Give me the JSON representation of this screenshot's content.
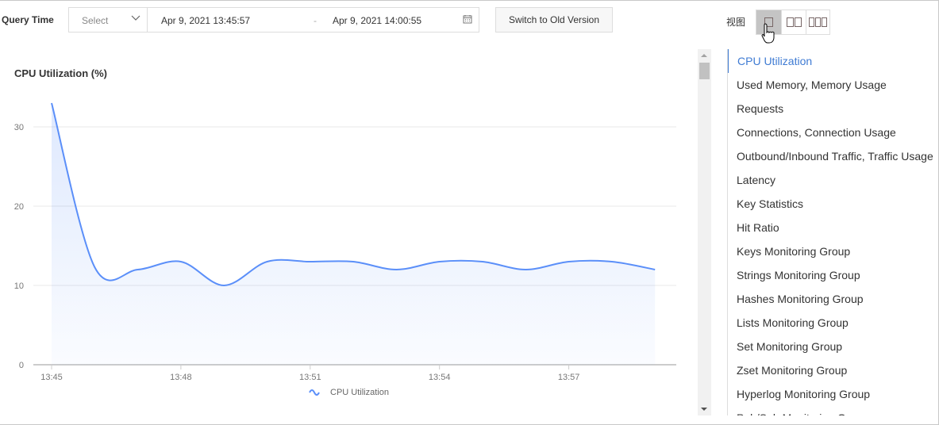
{
  "toolbar": {
    "query_time_label": "Query Time",
    "select_placeholder": "Select",
    "start_time": "Apr 9, 2021 13:45:57",
    "separator": "-",
    "end_time": "Apr 9, 2021 14:00:55",
    "switch_label": "Switch to Old Version",
    "view_label": "视图"
  },
  "chart_data": {
    "type": "area",
    "title": "CPU Utilization (%)",
    "xlabel": "",
    "ylabel": "",
    "x": [
      "13:45",
      "13:46",
      "13:47",
      "13:48",
      "13:49",
      "13:50",
      "13:51",
      "13:52",
      "13:53",
      "13:54",
      "13:55",
      "13:56",
      "13:57",
      "13:58",
      "13:59"
    ],
    "series": [
      {
        "name": "CPU Utilization",
        "values": [
          33,
          12.3,
          12,
          13,
          10,
          13,
          13,
          13,
          12,
          13,
          13,
          12,
          13,
          13,
          12
        ]
      }
    ],
    "x_ticks": [
      "13:45",
      "13:48",
      "13:51",
      "13:54",
      "13:57"
    ],
    "y_ticks": [
      "0",
      "10",
      "20",
      "30"
    ],
    "ylim": [
      0,
      30
    ],
    "grid": true,
    "legend": "bottom",
    "line_color": "#5b8ff9"
  },
  "nav": {
    "items": [
      "CPU Utilization",
      "Used Memory, Memory Usage",
      "Requests",
      "Connections, Connection Usage",
      "Outbound/Inbound Traffic, Traffic Usage",
      "Latency",
      "Key Statistics",
      "Hit Ratio",
      "Keys Monitoring Group",
      "Strings Monitoring Group",
      "Hashes Monitoring Group",
      "Lists Monitoring Group",
      "Set Monitoring Group",
      "Zset Monitoring Group",
      "Hyperlog Monitoring Group",
      "Pub/Sub Monitoring Group"
    ]
  }
}
